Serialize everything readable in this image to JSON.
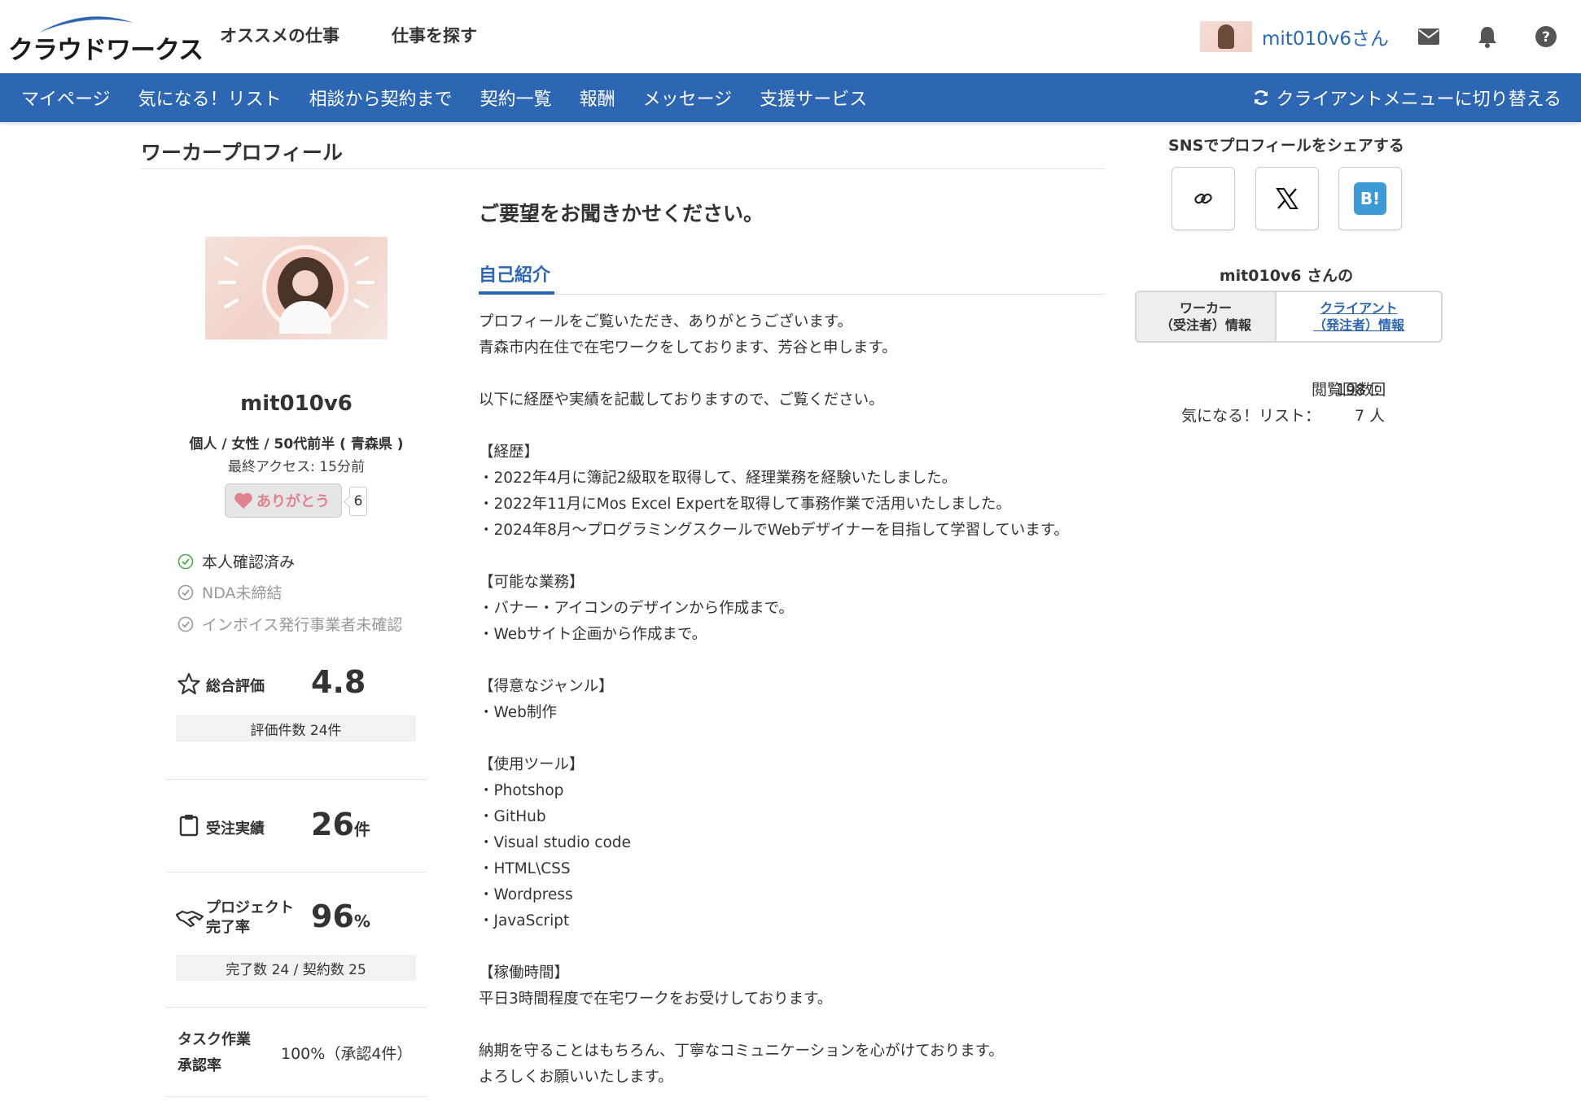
{
  "header": {
    "logo_text": "クラウドワークス",
    "nav": [
      "オススメの仕事",
      "仕事を探す"
    ],
    "username": "mit010v6さん"
  },
  "subnav": {
    "items": [
      "マイページ",
      "気になる！リスト",
      "相談から契約まで",
      "契約一覧",
      "報酬",
      "メッセージ",
      "支援サービス"
    ],
    "switch_label": "クライアントメニューに切り替える"
  },
  "page_title": "ワーカープロフィール",
  "profile": {
    "name": "mit010v6",
    "meta": "個人 / 女性 / 50代前半 ( 青森県 )",
    "last_access": "最終アクセス: 15分前",
    "thanks_label": "ありがとう",
    "thanks_count": "6",
    "checks": [
      {
        "label": "本人確認済み",
        "color": "#4cae4c"
      },
      {
        "label": "NDA未締結",
        "color": "#999999"
      },
      {
        "label": "インボイス発行事業者未確認",
        "color": "#999999"
      }
    ],
    "rating_label": "総合評価",
    "rating_value": "4.8",
    "rating_count": "評価件数 24件",
    "orders_label": "受注実績",
    "orders_value": "26",
    "orders_unit": "件",
    "completion_label_1": "プロジェクト",
    "completion_label_2": "完了率",
    "completion_value": "96",
    "completion_unit": "%",
    "completion_detail": "完了数 24 / 契約数 25",
    "task_label_1": "タスク作業",
    "task_label_2": "承認率",
    "task_value": "100%（承認4件）"
  },
  "main": {
    "request_title": "ご要望をお聞きかせください。",
    "tab_label": "自己紹介",
    "intro_text": "プロフィールをご覧いただき、ありがとうございます。\n青森市内在住で在宅ワークをしております、芳谷と申します。\n\n以下に経歴や実績を記載しておりますので、ご覧ください。\n\n【経歴】\n・2022年4月に簿記2級取を取得して、経理業務を経験いたしました。\n・2022年11月にMos Excel Expertを取得して事務作業で活用いたしました。\n・2024年8月～プログラミングスクールでWebデザイナーを目指して学習しています。\n\n【可能な業務】\n・バナー・アイコンのデザインから作成まで。\n・Webサイト企画から作成まで。\n\n【得意なジャンル】\n・Web制作\n\n【使用ツール】\n・Photshop\n・GitHub\n・Visual studio code\n・HTML\\CSS\n・Wordpress\n・JavaScript\n\n【稼働時間】\n平日3時間程度で在宅ワークをお受けしております。\n\n納期を守ることはもちろん、丁寧なコミュニケーションを心がけております。\nよろしくお願いいたします。"
  },
  "sidebar": {
    "sns_title": "SNSでプロフィールをシェアする",
    "hatena_label": "B!",
    "owner_label": "mit010v6 さんの",
    "worker_tab": "ワーカー\n（受注者）情報",
    "client_tab": "クライアント\n（発注者）情報",
    "views_label": "閲覧回数：",
    "views_value": "198 回",
    "fav_label": "気になる！リスト：",
    "fav_value": "7 人"
  },
  "colors": {
    "brand_blue": "#2d66b3",
    "link_blue": "#2868b3",
    "thanks_pink": "#e2828e"
  }
}
